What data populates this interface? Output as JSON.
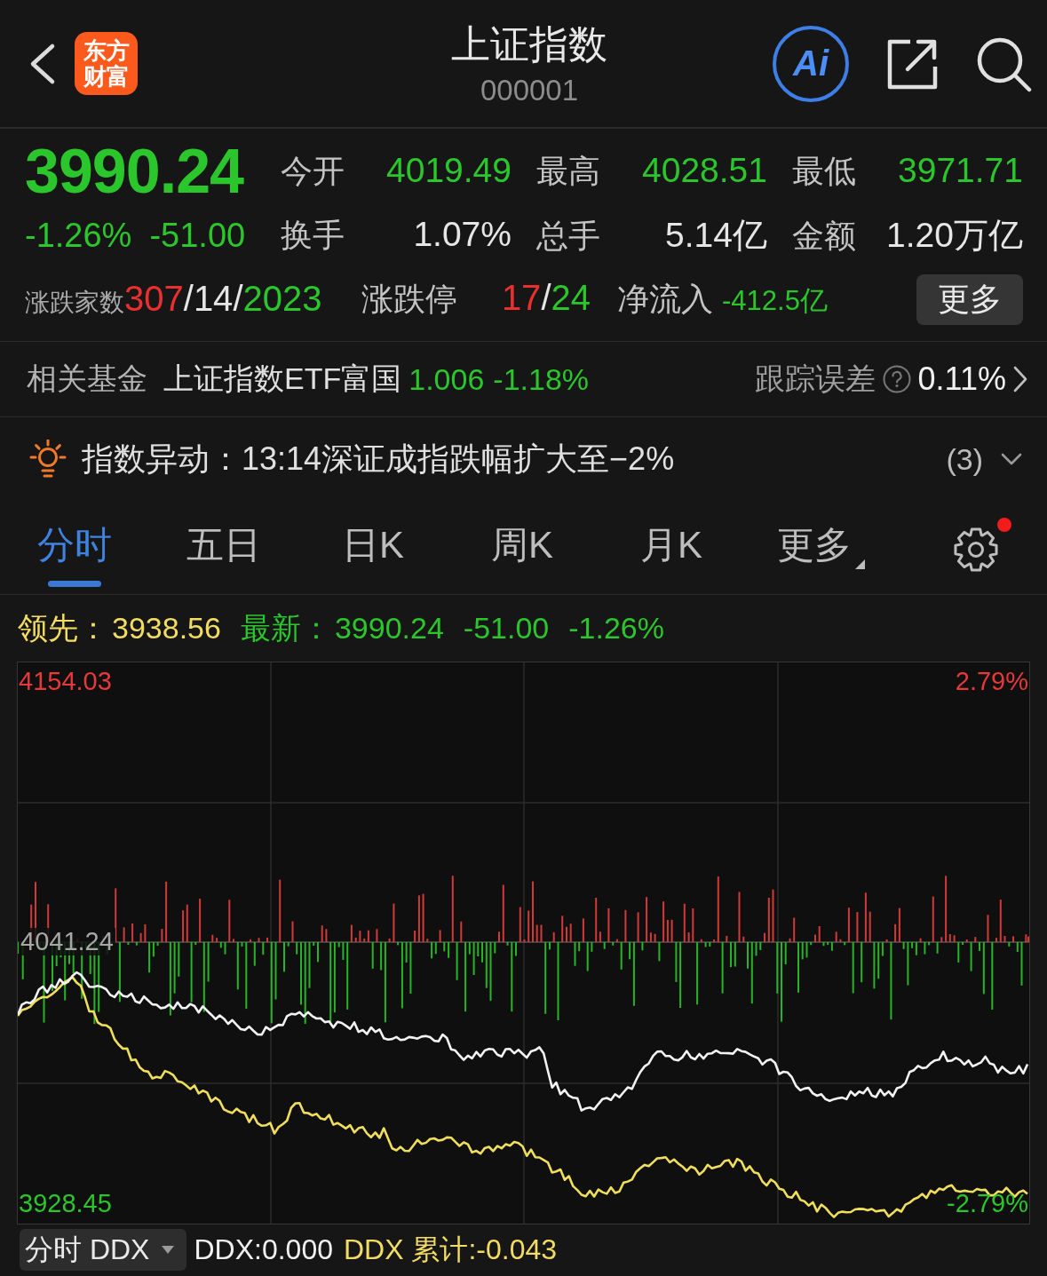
{
  "header": {
    "logo": "东方财富",
    "title": "上证指数",
    "code": "000001",
    "ai_label": "Ai"
  },
  "quote": {
    "price": "3990.24",
    "change_percent": "-1.26%",
    "change": "-51.00",
    "color": "#2bc62b",
    "stats": [
      {
        "label": "今开",
        "value": "4019.49",
        "color": "#2bc62b"
      },
      {
        "label": "最高",
        "value": "4028.51",
        "color": "#2bc62b"
      },
      {
        "label": "最低",
        "value": "3971.71",
        "color": "#2bc62b"
      },
      {
        "label": "换手",
        "value": "1.07%",
        "color": "#e6e6e6"
      },
      {
        "label": "总手",
        "value": "5.14亿",
        "color": "#e6e6e6"
      },
      {
        "label": "金额",
        "value": "1.20万亿",
        "color": "#e6e6e6"
      }
    ],
    "breadth": {
      "label": "涨跌家数",
      "parts": [
        {
          "text": "307",
          "color": "#ea2f2f"
        },
        {
          "text": "/",
          "color": "#e6e6e6"
        },
        {
          "text": "14",
          "color": "#e6e6e6"
        },
        {
          "text": "/",
          "color": "#e6e6e6"
        },
        {
          "text": "2023",
          "color": "#2bc62b"
        }
      ]
    },
    "limits": {
      "label": "涨跌停",
      "parts": [
        {
          "text": "17",
          "color": "#ea2f2f"
        },
        {
          "text": "/",
          "color": "#e6e6e6"
        },
        {
          "text": "24",
          "color": "#2bc62b"
        }
      ]
    },
    "net_inflow": {
      "label": "净流入",
      "value": "-412.5亿",
      "color": "#2bc62b"
    },
    "more_button": "更多"
  },
  "fund": {
    "label": "相关基金",
    "name": "上证指数ETF富国",
    "price": "1.006",
    "change": "-1.18%",
    "color": "#2bc62b",
    "tracking_label": "跟踪误差",
    "tracking_value": "0.11%"
  },
  "alert": {
    "text": "指数异动：13:14深证成指跌幅扩大至−2%",
    "count": "(3)",
    "expanded": false
  },
  "tabs": [
    {
      "label": "分时",
      "selected": true,
      "kind": "tab"
    },
    {
      "label": "五日",
      "selected": false,
      "kind": "tab"
    },
    {
      "label": "日K",
      "selected": false,
      "kind": "tab"
    },
    {
      "label": "周K",
      "selected": false,
      "kind": "tab"
    },
    {
      "label": "月K",
      "selected": false,
      "kind": "tab"
    },
    {
      "label": "更多",
      "selected": false,
      "kind": "menu"
    }
  ],
  "settings": {
    "notification": true
  },
  "legend": {
    "lead_label": "领先：",
    "lead_value": "3938.56",
    "latest_label": "最新：",
    "latest_value": "3990.24",
    "change": "-51.00",
    "change_percent": "-1.26%",
    "color": "#2bc62b"
  },
  "chart": {
    "top_price": "4154.03",
    "top_percent": "2.79%",
    "mid_price": "4041.24",
    "bottom_price": "3928.45",
    "bottom_percent": "-2.79%"
  },
  "indicator": {
    "selector": "分时 DDX",
    "ddx": "DDX:0.000",
    "ddx_total": "DDX 累计:-0.043"
  }
}
